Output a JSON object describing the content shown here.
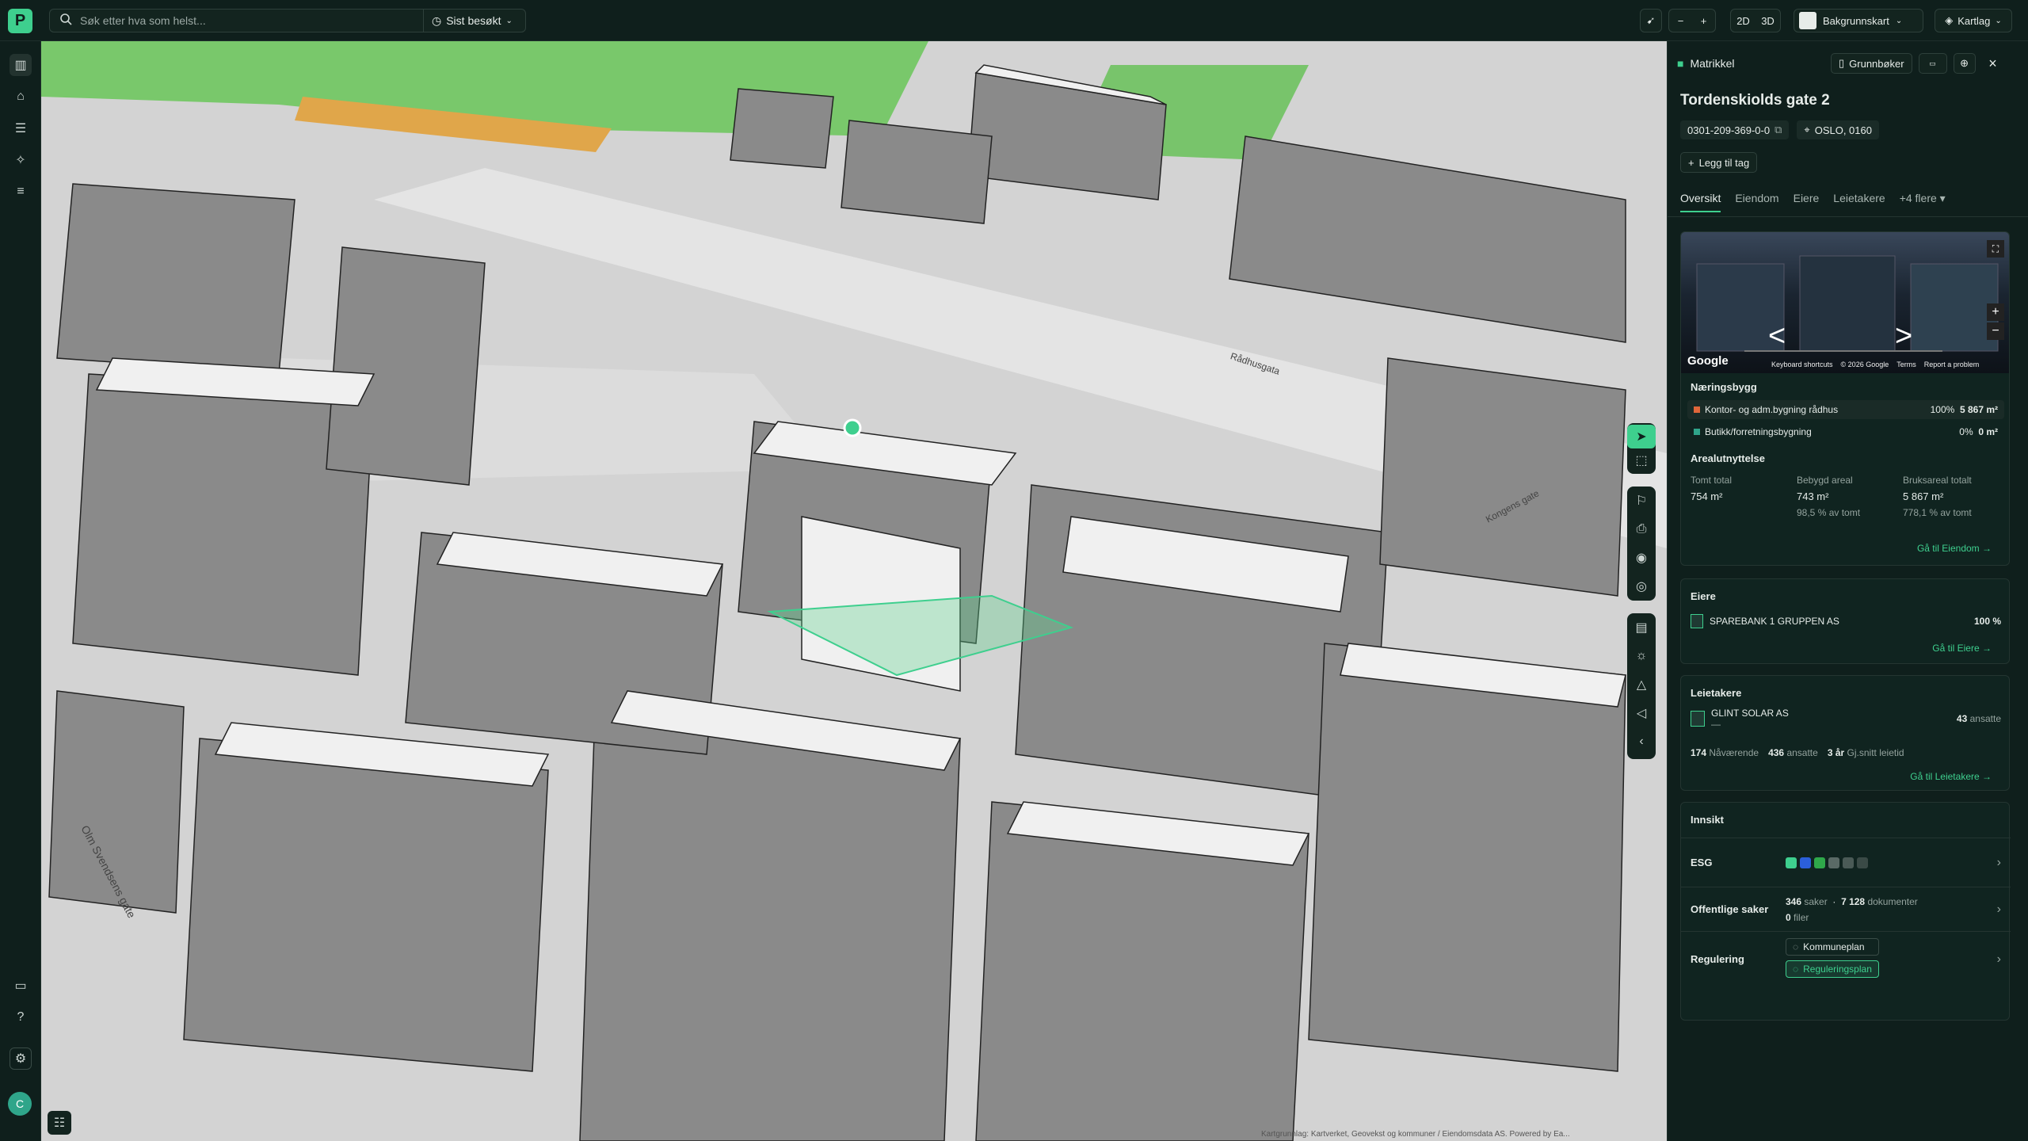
{
  "topbar": {
    "logo_letter": "P",
    "search_placeholder": "Søk etter hva som helst...",
    "recent_label": "Sist besøkt",
    "zoom_out": "−",
    "zoom_in": "+",
    "mode_2d": "2D",
    "mode_3d": "3D",
    "basemap_label": "Bakgrunnskart",
    "layers_label": "Kartlag"
  },
  "sidebar": {
    "user_initial": "C"
  },
  "map": {
    "street_labels": [
      "Olm Svendsens gate",
      "Rådhusgata",
      "Kongens gate"
    ],
    "attribution": "Kartgrunnlag: Kartverket, Geovekst og kommuner / Eiendomsdata AS. Powered by Ea..."
  },
  "panel": {
    "header_label": "Matrikkel",
    "grunnboker_label": "Grunnbøker",
    "title": "Tordenskiolds gate 2",
    "matrikkel_id": "0301-209-369-0-0",
    "location": "OSLO, 0160",
    "add_tag_label": "Legg til tag",
    "tabs": [
      "Oversikt",
      "Eiendom",
      "Eiere",
      "Leietakere",
      "+4 flere"
    ],
    "streetview": {
      "google": "Google",
      "keyboard": "Keyboard shortcuts",
      "copyright": "© 2026 Google",
      "terms": "Terms",
      "report": "Report a problem"
    },
    "naeringsbygg": {
      "title": "Næringsbygg",
      "items": [
        {
          "label": "Kontor- og adm.bygning rådhus",
          "pct": "100%",
          "area": "5 867 m²",
          "color": "#e0663a"
        },
        {
          "label": "Butikk/forretningsbygning",
          "pct": "0%",
          "area": "0 m²",
          "color": "#2fa58a"
        }
      ]
    },
    "areal": {
      "title": "Arealutnyttelse",
      "cols": [
        {
          "label": "Tomt total",
          "value": "754 m²",
          "sub": ""
        },
        {
          "label": "Bebygd areal",
          "value": "743 m²",
          "sub": "98,5 % av tomt"
        },
        {
          "label": "Bruksareal totalt",
          "value": "5 867 m²",
          "sub": "778,1 % av tomt"
        }
      ],
      "link": "Gå til Eiendom →"
    },
    "eiere": {
      "title": "Eiere",
      "owner": "SPAREBANK 1 GRUPPEN AS",
      "share": "100 %",
      "link": "Gå til Eiere →"
    },
    "leietakere": {
      "title": "Leietakere",
      "tenant": "GLINT SOLAR AS",
      "tenant_sub": "—",
      "employees": "43",
      "employees_label": "ansatte",
      "stat1_value": "174",
      "stat1_label": "Nåværende",
      "stat2_value": "436",
      "stat2_label": "ansatte",
      "stat3_value": "3 år",
      "stat3_label": "Gj.snitt leietid",
      "link": "Gå til Leietakere →"
    },
    "innsikt": {
      "title": "Innsikt",
      "esg_label": "ESG",
      "offentlige_label": "Offentlige saker",
      "saker_value": "346",
      "saker_label": "saker",
      "dok_value": "7 128",
      "dok_label": "dokumenter",
      "filer_value": "0",
      "filer_label": "filer",
      "regulering_label": "Regulering",
      "kommuneplan": "Kommuneplan",
      "reguleringsplan": "Reguleringsplan"
    }
  }
}
